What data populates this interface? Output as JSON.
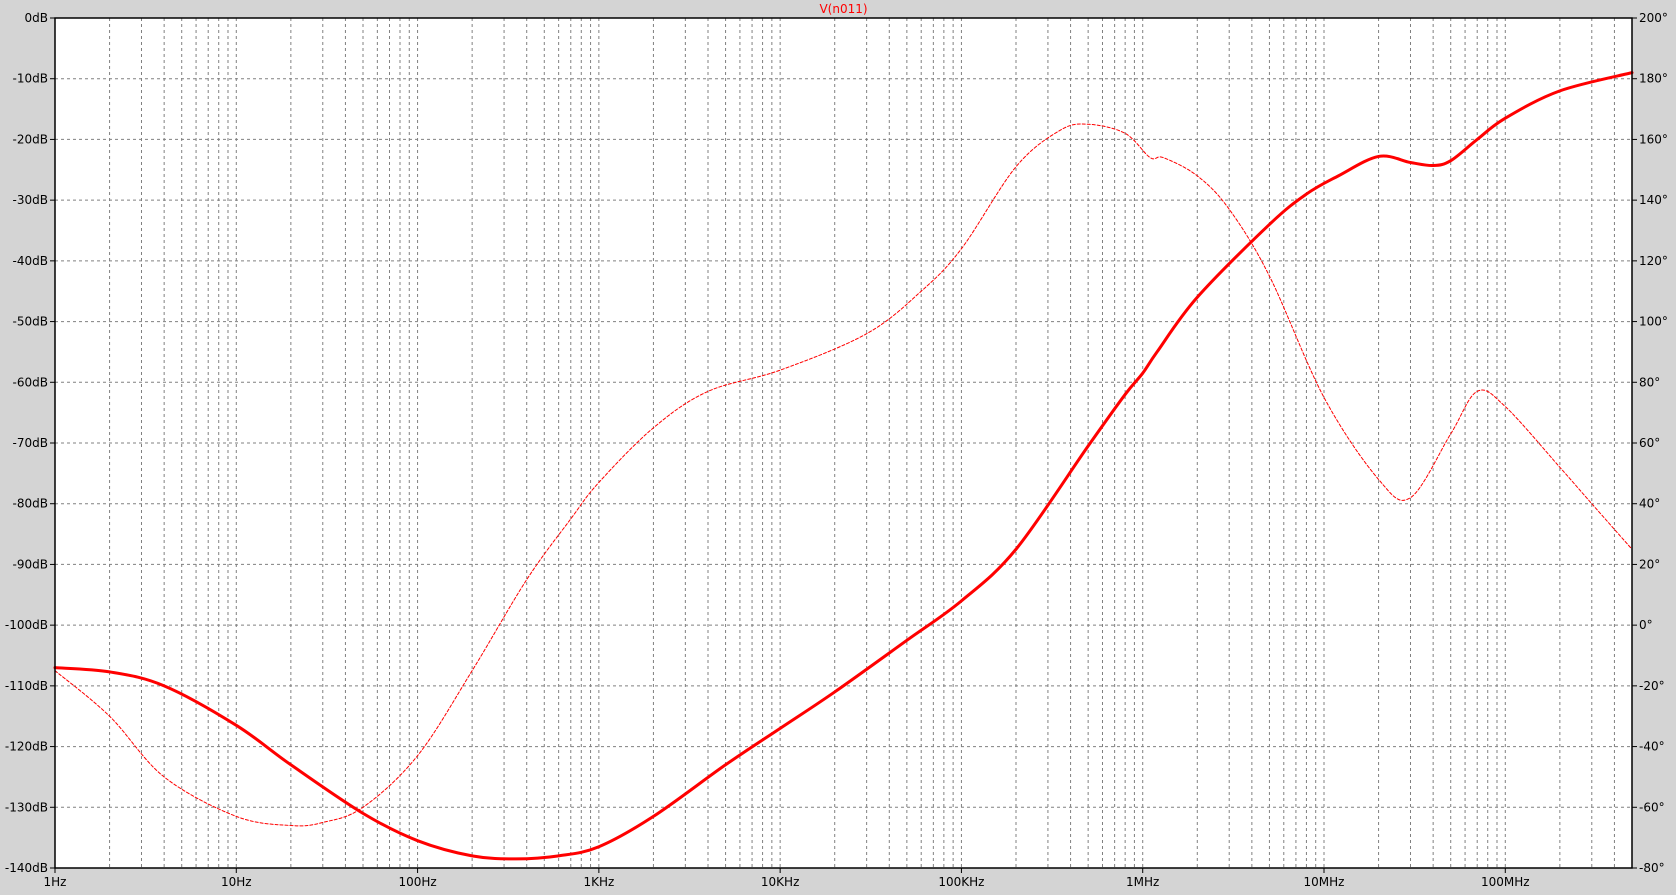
{
  "colors": {
    "background": "#d4d4d4",
    "plot_area": "#ffffff",
    "grid": "#808080",
    "trace": "#ff0000",
    "text": "#000000"
  },
  "chart_data": {
    "type": "line",
    "title": "V(n011)",
    "x_scale": "log",
    "xlim": [
      1,
      500000000
    ],
    "x_ticks": [
      {
        "value": 1,
        "label": "1Hz"
      },
      {
        "value": 10,
        "label": "10Hz"
      },
      {
        "value": 100,
        "label": "100Hz"
      },
      {
        "value": 1000,
        "label": "1KHz"
      },
      {
        "value": 10000,
        "label": "10KHz"
      },
      {
        "value": 100000,
        "label": "100KHz"
      },
      {
        "value": 1000000,
        "label": "1MHz"
      },
      {
        "value": 10000000,
        "label": "10MHz"
      },
      {
        "value": 100000000,
        "label": "100MHz"
      }
    ],
    "left_axis": {
      "unit": "dB",
      "ylim": [
        -140,
        0
      ],
      "ticks": [
        {
          "value": 0,
          "label": "0dB"
        },
        {
          "value": -10,
          "label": "-10dB"
        },
        {
          "value": -20,
          "label": "-20dB"
        },
        {
          "value": -30,
          "label": "-30dB"
        },
        {
          "value": -40,
          "label": "-40dB"
        },
        {
          "value": -50,
          "label": "-50dB"
        },
        {
          "value": -60,
          "label": "-60dB"
        },
        {
          "value": -70,
          "label": "-70dB"
        },
        {
          "value": -80,
          "label": "-80dB"
        },
        {
          "value": -90,
          "label": "-90dB"
        },
        {
          "value": -100,
          "label": "-100dB"
        },
        {
          "value": -110,
          "label": "-110dB"
        },
        {
          "value": -120,
          "label": "-120dB"
        },
        {
          "value": -130,
          "label": "-130dB"
        },
        {
          "value": -140,
          "label": "-140dB"
        }
      ]
    },
    "right_axis": {
      "unit": "°",
      "ylim": [
        -80,
        200
      ],
      "ticks": [
        {
          "value": 200,
          "label": "200°"
        },
        {
          "value": 180,
          "label": "180°"
        },
        {
          "value": 160,
          "label": "160°"
        },
        {
          "value": 140,
          "label": "140°"
        },
        {
          "value": 120,
          "label": "120°"
        },
        {
          "value": 100,
          "label": "100°"
        },
        {
          "value": 80,
          "label": "80°"
        },
        {
          "value": 60,
          "label": "60°"
        },
        {
          "value": 40,
          "label": "40°"
        },
        {
          "value": 20,
          "label": "20°"
        },
        {
          "value": 0,
          "label": "0°"
        },
        {
          "value": -20,
          "label": "-20°"
        },
        {
          "value": -40,
          "label": "-40°"
        },
        {
          "value": -60,
          "label": "-60°"
        },
        {
          "value": -80,
          "label": "-80°"
        }
      ]
    },
    "grid": true,
    "series": [
      {
        "axis": "left",
        "style": "solid",
        "x": [
          1,
          2,
          4,
          10,
          20,
          50,
          100,
          200,
          350,
          600,
          1000,
          2000,
          5000,
          10000,
          20000,
          50000,
          100000,
          200000,
          500000,
          800000,
          1000000,
          1200000,
          2000000,
          5000000,
          8000000,
          12000000,
          20000000,
          30000000,
          40000000,
          50000000,
          70000000,
          100000000,
          200000000,
          500000000
        ],
        "values": [
          -107,
          -107.7,
          -110,
          -116.5,
          -123,
          -131,
          -135.5,
          -138,
          -138.5,
          -138,
          -136.5,
          -131.5,
          -123,
          -117,
          -111,
          -102.5,
          -96,
          -87.5,
          -70.5,
          -62,
          -58.5,
          -55,
          -46,
          -34,
          -29,
          -26,
          -22.8,
          -23.8,
          -24.3,
          -23.5,
          -20,
          -16.5,
          -12,
          -9
        ]
      },
      {
        "axis": "right",
        "style": "dashed",
        "x": [
          1,
          2,
          4,
          10,
          20,
          30,
          50,
          100,
          200,
          400,
          700,
          1000,
          2000,
          4000,
          10000,
          30000,
          60000,
          100000,
          200000,
          350000,
          500000,
          800000,
          1100000,
          1300000,
          2000000,
          3000000,
          5000000,
          10000000,
          20000000,
          30000000,
          50000000,
          70000000,
          100000000,
          200000000,
          300000000,
          500000000
        ],
        "values": [
          -15,
          -30,
          -50,
          -63,
          -66,
          -65,
          -60,
          -43,
          -15,
          15,
          35,
          47,
          65,
          77,
          84,
          96,
          110,
          124,
          151,
          163,
          165,
          162,
          154,
          154,
          148,
          137,
          115,
          75,
          48,
          42,
          63,
          77,
          72,
          52,
          40,
          25
        ]
      }
    ]
  }
}
